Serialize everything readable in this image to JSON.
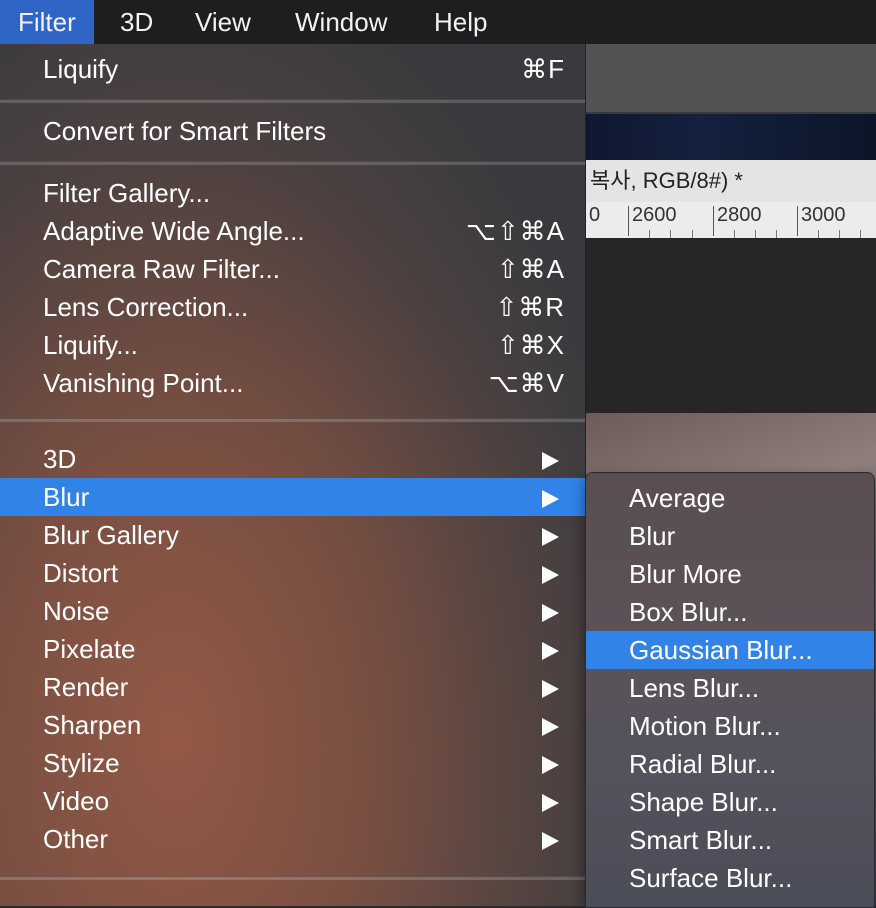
{
  "menubar": {
    "items": [
      {
        "label": "Filter",
        "active": true
      },
      {
        "label": "3D"
      },
      {
        "label": "View"
      },
      {
        "label": "Window"
      },
      {
        "label": "Help"
      }
    ]
  },
  "background_window": {
    "document_title": "복사, RGB/8#) *",
    "ruler_ticks": [
      "0",
      "2600",
      "2800",
      "3000"
    ]
  },
  "filter_menu": {
    "top": {
      "label": "Liquify",
      "shortcut": "⌘F"
    },
    "smart": {
      "label": "Convert for Smart Filters"
    },
    "group": [
      {
        "label": "Filter Gallery...",
        "shortcut": ""
      },
      {
        "label": "Adaptive Wide Angle...",
        "shortcut": "⌥⇧⌘A"
      },
      {
        "label": "Camera Raw Filter...",
        "shortcut": "⇧⌘A"
      },
      {
        "label": "Lens Correction...",
        "shortcut": "⇧⌘R"
      },
      {
        "label": "Liquify...",
        "shortcut": "⇧⌘X"
      },
      {
        "label": "Vanishing Point...",
        "shortcut": "⌥⌘V"
      }
    ],
    "submenus": [
      {
        "label": "3D"
      },
      {
        "label": "Blur",
        "highlighted": true
      },
      {
        "label": "Blur Gallery"
      },
      {
        "label": "Distort"
      },
      {
        "label": "Noise"
      },
      {
        "label": "Pixelate"
      },
      {
        "label": "Render"
      },
      {
        "label": "Sharpen"
      },
      {
        "label": "Stylize"
      },
      {
        "label": "Video"
      },
      {
        "label": "Other"
      }
    ]
  },
  "blur_submenu": {
    "items": [
      {
        "label": "Average"
      },
      {
        "label": "Blur"
      },
      {
        "label": "Blur More"
      },
      {
        "label": "Box Blur..."
      },
      {
        "label": "Gaussian Blur...",
        "highlighted": true
      },
      {
        "label": "Lens Blur..."
      },
      {
        "label": "Motion Blur..."
      },
      {
        "label": "Radial Blur..."
      },
      {
        "label": "Shape Blur..."
      },
      {
        "label": "Smart Blur..."
      },
      {
        "label": "Surface Blur..."
      }
    ]
  },
  "colors": {
    "highlight": "#3283e8",
    "menubar_active": "#2f66c6"
  }
}
